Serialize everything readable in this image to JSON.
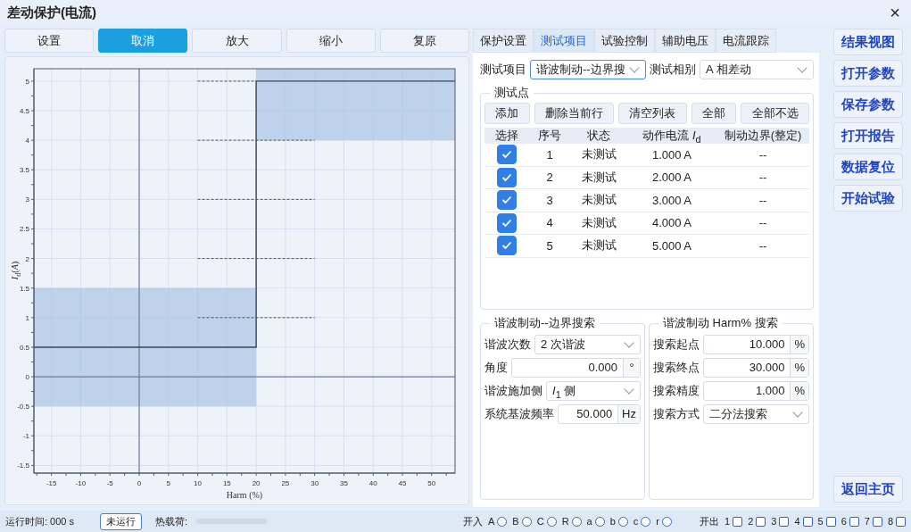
{
  "window": {
    "title": "差动保护(电流)",
    "close": "×"
  },
  "toolbar": [
    {
      "label": "设置",
      "selected": false
    },
    {
      "label": "取消",
      "selected": true
    },
    {
      "label": "放大",
      "selected": false
    },
    {
      "label": "缩小",
      "selected": false
    },
    {
      "label": "复原",
      "selected": false
    }
  ],
  "chart": {
    "chart_data": {
      "type": "line",
      "xlabel": "Harm (%)",
      "ylabel": "*I*$_{d}$(*A*)",
      "x": [
        -18,
        10,
        20,
        20,
        30,
        54
      ],
      "series": [
        {
          "color": "#3a4656",
          "line_style": "solid",
          "values": [
            0.5,
            0.5,
            0.5,
            5,
            5,
            5
          ]
        },
        {
          "color": "#555555",
          "line_style": "dashed",
          "values": [
            null,
            1,
            1,
            1,
            1,
            null
          ]
        },
        {
          "color": "#555555",
          "line_style": "dashed",
          "values": [
            null,
            2,
            2,
            2,
            2,
            null
          ]
        },
        {
          "color": "#555555",
          "line_style": "dashed",
          "values": [
            null,
            3,
            3,
            3,
            3,
            null
          ]
        },
        {
          "color": "#555555",
          "line_style": "dashed",
          "values": [
            null,
            4,
            4,
            4,
            4,
            null
          ]
        },
        {
          "color": "#555555",
          "line_style": "dashed",
          "values": [
            null,
            5,
            5,
            null,
            null,
            null
          ]
        }
      ],
      "grid": true,
      "xlim": [
        -18,
        54
      ],
      "ylim": [
        -1.63,
        5.21
      ],
      "xticks": [
        -15,
        -10,
        -5,
        0,
        5,
        10,
        15,
        20,
        25,
        30,
        35,
        40,
        45,
        50
      ],
      "yticks": [
        -1.5,
        -1,
        -0.5,
        0,
        0.5,
        1,
        1.5,
        2,
        2.5,
        3,
        3.5,
        4,
        4.5,
        5
      ]
    }
  },
  "tabs": [
    {
      "label": "保护设置",
      "selected": false
    },
    {
      "label": "测试项目",
      "selected": true
    },
    {
      "label": "试验控制",
      "selected": false
    },
    {
      "label": "辅助电压",
      "selected": false
    },
    {
      "label": "电流跟踪",
      "selected": false
    }
  ],
  "test_item": {
    "label": "测试项目",
    "value": "谐波制动--边界搜"
  },
  "test_phase": {
    "label": "测试相别",
    "value": "A 相差动"
  },
  "test_points": {
    "title": "测试点",
    "buttons": [
      "添加",
      "删除当前行",
      "清空列表",
      "全部",
      "全部不选"
    ],
    "columns": [
      "选择",
      "序号",
      "状态",
      "动作电流 *I*$_{d}$",
      "制动边界(整定)"
    ],
    "rows": [
      {
        "checked": true,
        "index": "1",
        "status": "未测试",
        "current": "1.000 A",
        "boundary": "--"
      },
      {
        "checked": true,
        "index": "2",
        "status": "未测试",
        "current": "2.000 A",
        "boundary": "--"
      },
      {
        "checked": true,
        "index": "3",
        "status": "未测试",
        "current": "3.000 A",
        "boundary": "--"
      },
      {
        "checked": true,
        "index": "4",
        "status": "未测试",
        "current": "4.000 A",
        "boundary": "--"
      },
      {
        "checked": true,
        "index": "5",
        "status": "未测试",
        "current": "5.000 A",
        "boundary": "--"
      }
    ]
  },
  "boundary_search": {
    "title": "谐波制动--边界搜索",
    "fields": [
      {
        "kind": "select",
        "label": "谐波次数",
        "value": "2 次谐波"
      },
      {
        "kind": "input",
        "label": "角度",
        "value": "0.000",
        "unit": "°"
      },
      {
        "kind": "select",
        "label": "谐波施加侧",
        "value": "*I*$_{1}$ 侧"
      },
      {
        "kind": "input",
        "label": "系统基波频率",
        "value": "50.000",
        "unit": "Hz"
      }
    ]
  },
  "harm_search": {
    "title": "谐波制动 Harm% 搜索",
    "fields": [
      {
        "kind": "input",
        "label": "搜索起点",
        "value": "10.000",
        "unit": "%"
      },
      {
        "kind": "input",
        "label": "搜索终点",
        "value": "30.000",
        "unit": "%"
      },
      {
        "kind": "input",
        "label": "搜索精度",
        "value": "1.000",
        "unit": "%"
      },
      {
        "kind": "select",
        "label": "搜索方式",
        "value": "二分法搜索"
      }
    ]
  },
  "side_buttons": [
    "结果视图",
    "打开参数",
    "保存参数",
    "打开报告",
    "数据复位",
    "开始试验"
  ],
  "home_button": "返回主页",
  "status_bar": {
    "run_time": "运行时间: 000 s",
    "run_state": "未运行",
    "heat_label": "热载荷:",
    "heat": {
      "level": 0
    },
    "inputs_label": "开入",
    "inputs": [
      {
        "label": "A",
        "on": false
      },
      {
        "label": "B",
        "on": false
      },
      {
        "label": "C",
        "on": false
      },
      {
        "label": "R",
        "on": false
      },
      {
        "label": "a",
        "on": false
      },
      {
        "label": "b",
        "on": false
      },
      {
        "label": "c",
        "on": false
      },
      {
        "label": "r",
        "on": false
      }
    ],
    "outputs_label": "开出",
    "outputs": [
      {
        "label": "1",
        "on": false
      },
      {
        "label": "2",
        "on": false
      },
      {
        "label": "3",
        "on": false
      },
      {
        "label": "4",
        "on": false
      },
      {
        "label": "5",
        "on": false
      },
      {
        "label": "6",
        "on": false
      },
      {
        "label": "7",
        "on": false
      },
      {
        "label": "8",
        "on": false
      }
    ]
  }
}
